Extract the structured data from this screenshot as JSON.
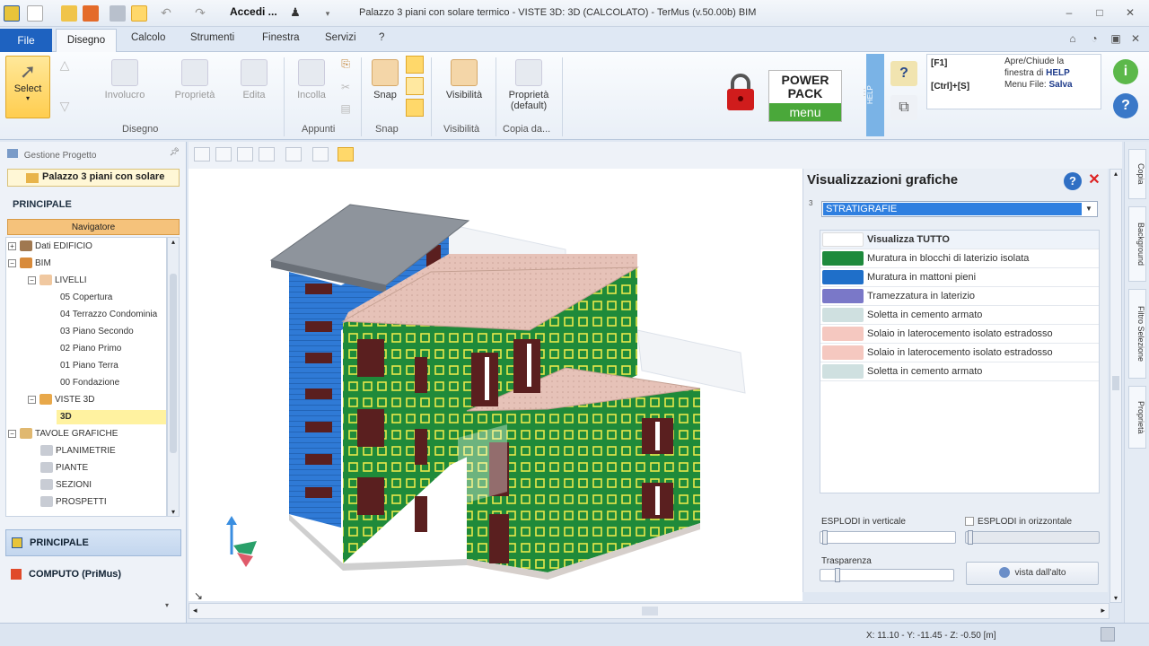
{
  "titlebar": {
    "title": "Palazzo 3 piani con solare termico - VISTE 3D: 3D (CALCOLATO) - TerMus (v.50.00b) BIM",
    "account": "Accedi ..."
  },
  "tabs": {
    "file": "File",
    "items": [
      "Disegno",
      "Calcolo",
      "Strumenti",
      "Finestra",
      "Servizi",
      "?"
    ]
  },
  "ribbon": {
    "select": "Select",
    "involucro": "Involucro",
    "proprieta": "Proprietà",
    "edita": "Edita",
    "incolla": "Incolla",
    "snap": "Snap",
    "visibilita": "Visibilità",
    "proprieta_default_1": "Proprietà",
    "proprieta_default_2": "(default)",
    "groups": {
      "disegno": "Disegno",
      "appunti": "Appunti",
      "snap": "Snap",
      "visibilita": "Visibilità",
      "copia": "Copia da..."
    },
    "powerpack_top": "POWER PACK",
    "powerpack_bottom": "menu",
    "help_strip": "HELP",
    "help": {
      "key1": "[F1]",
      "key2": "[Ctrl]+[S]",
      "line1": "Apre/Chiude la",
      "line2a": "finestra di ",
      "line2b": "HELP",
      "line3a": "Menu File: ",
      "line3b": "Salva"
    }
  },
  "left": {
    "header": "Gestione Progetto",
    "project_tab": "Palazzo 3 piani con solare",
    "principale_label": "PRINCIPALE",
    "navigatore": "Navigatore",
    "tree": [
      {
        "label": "Dati EDIFICIO"
      },
      {
        "label": "BIM"
      },
      {
        "label": "LIVELLI"
      },
      {
        "label": "05 Copertura"
      },
      {
        "label": "04 Terrazzo Condominia"
      },
      {
        "label": "03 Piano Secondo"
      },
      {
        "label": "02 Piano Primo"
      },
      {
        "label": "01 Piano Terra"
      },
      {
        "label": "00 Fondazione"
      },
      {
        "label": "VISTE 3D"
      },
      {
        "label": "3D"
      },
      {
        "label": "TAVOLE GRAFICHE"
      },
      {
        "label": "PLANIMETRIE"
      },
      {
        "label": "PIANTE"
      },
      {
        "label": "SEZIONI"
      },
      {
        "label": "PROSPETTI"
      }
    ],
    "nav_principale": "PRINCIPALE",
    "nav_computo": "COMPUTO (PriMus)"
  },
  "panel": {
    "title": "Visualizzazioni grafiche",
    "select_value": "STRATIGRAFIE",
    "num_marker": "3",
    "layers": [
      {
        "name": "Visualizza TUTTO",
        "color": "#ffffff"
      },
      {
        "name": "Muratura in blocchi di laterizio isolata",
        "color": "#1e8a3c"
      },
      {
        "name": "Muratura in mattoni pieni",
        "color": "#1f6fc9"
      },
      {
        "name": "Tramezzatura in laterizio",
        "color": "#7a78c8"
      },
      {
        "name": "Soletta in cemento armato",
        "color": "#cfe0e0"
      },
      {
        "name": "Solaio in laterocemento isolato estradosso",
        "color": "#f5c8c0"
      },
      {
        "name": "Solaio in laterocemento isolato estradosso",
        "color": "#f5c8c0"
      },
      {
        "name": "Soletta in cemento armato",
        "color": "#cfe0e0"
      }
    ],
    "esplodi_v": "ESPLODI in verticale",
    "esplodi_o": "ESPLODI in orizzontale",
    "trasparenza": "Trasparenza",
    "vista_btn": "vista dall'alto"
  },
  "side_tabs": [
    "Copia",
    "Background",
    "Filtro Selezione",
    "Proprietà"
  ],
  "status": {
    "coords": "X: 11.10 - Y: -11.45 - Z: -0.50 [m]"
  }
}
